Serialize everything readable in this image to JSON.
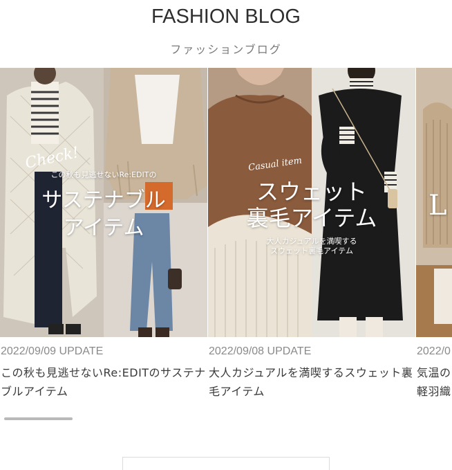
{
  "header": {
    "title": "FASHION BLOG",
    "subtitle": "ファッションブログ"
  },
  "articles": [
    {
      "date": "2022/09/09 UPDATE",
      "title": "この秋も見逃せないRe:EDITのサステナブルアイテム",
      "image": {
        "script": "Check!",
        "lead": "この秋も見逃せないRe:EDITの",
        "headline_1": "サステナブル",
        "headline_2": "アイテム"
      }
    },
    {
      "date": "2022/09/08 UPDATE",
      "title": "大人カジュアルを満喫するスウェット裏毛アイテム",
      "image": {
        "script": "Casual item",
        "headline_1": "スウェット",
        "headline_2": "裏毛アイテム",
        "sub_1": "大人カジュアルを満喫する",
        "sub_2": "スウェット裏毛アイテム"
      }
    },
    {
      "date": "2022/0",
      "title": "気温の軽羽織",
      "image": {
        "headline_1": "L"
      }
    }
  ],
  "colors": {
    "title": "#2f2f2f",
    "subtitle": "#7a7a7a",
    "date": "#8a8a8a",
    "scrollbar": "#b9b9b9"
  }
}
